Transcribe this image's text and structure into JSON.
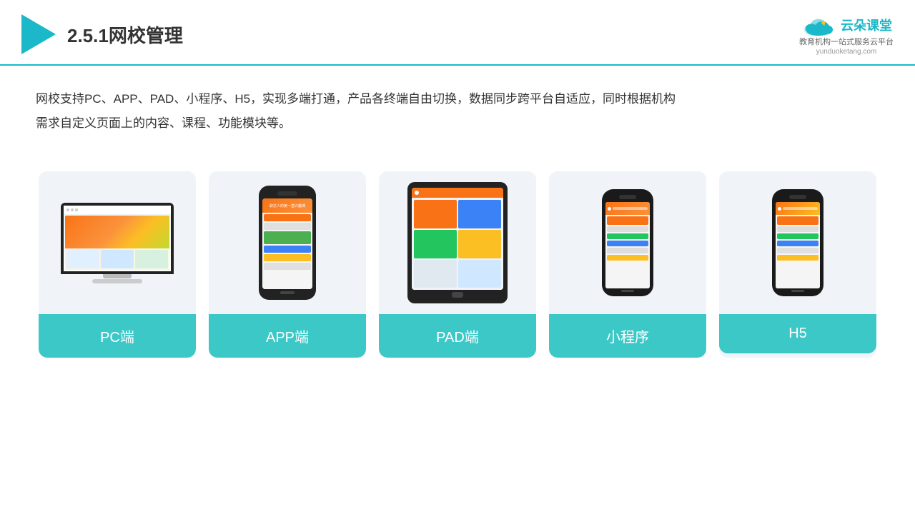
{
  "header": {
    "title": "2.5.1网校管理",
    "brand": {
      "name": "云朵课堂",
      "tagline": "教育机构一站\n式服务云平台",
      "url": "yunduoketang.com"
    }
  },
  "description": {
    "line1": "网校支持PC、APP、PAD、小程序、H5，实现多端打通，产品各终端自由切换，数据同步跨平台自适应，同时根据机构",
    "line2": "需求自定义页面上的内容、课程、功能模块等。"
  },
  "cards": [
    {
      "id": "pc",
      "label": "PC端"
    },
    {
      "id": "app",
      "label": "APP端"
    },
    {
      "id": "pad",
      "label": "PAD端"
    },
    {
      "id": "miniapp",
      "label": "小程序"
    },
    {
      "id": "h5",
      "label": "H5"
    }
  ]
}
